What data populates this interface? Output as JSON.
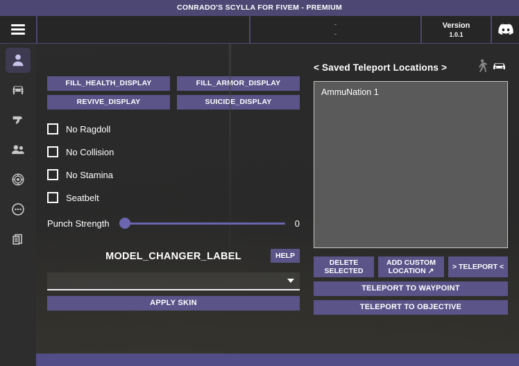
{
  "window": {
    "title": "CONRADO'S SCYLLA FOR FIVEM - PREMIUM"
  },
  "topbar": {
    "menu_icon": "hamburger-menu-icon",
    "blank_panel": "",
    "coords_line1": "-",
    "coords_line2": "-",
    "version_label": "Version",
    "version_number": "1.0.1",
    "discord_icon": "discord-icon"
  },
  "sidebar": {
    "items": [
      {
        "name": "player",
        "icon": "person-icon",
        "active": true
      },
      {
        "name": "vehicle",
        "icon": "car-icon",
        "active": false
      },
      {
        "name": "weapons",
        "icon": "pistol-icon",
        "active": false
      },
      {
        "name": "players",
        "icon": "people-icon",
        "active": false
      },
      {
        "name": "esp",
        "icon": "radar-icon",
        "active": false
      },
      {
        "name": "misc",
        "icon": "dots-circle-icon",
        "active": false
      },
      {
        "name": "logs",
        "icon": "documents-icon",
        "active": false
      }
    ]
  },
  "player_panel": {
    "buttons_row1": [
      "FILL_HEALTH_DISPLAY",
      "FILL_ARMOR_DISPLAY"
    ],
    "buttons_row2": [
      "REVIVE_DISPLAY",
      "SUICIDE_DISPLAY"
    ],
    "checkboxes": [
      {
        "label": "No Ragdoll",
        "checked": false
      },
      {
        "label": "No Collision",
        "checked": false
      },
      {
        "label": "No Stamina",
        "checked": false
      },
      {
        "label": "Seatbelt",
        "checked": false
      }
    ],
    "slider": {
      "label": "Punch Strength",
      "value": "0",
      "percent": 0
    },
    "model_changer": {
      "title": "MODEL_CHANGER_LABEL",
      "help_label": "HELP",
      "dropdown_value": "",
      "dropdown_caret": "chevron-down-icon",
      "apply_label": "APPLY SKIN"
    }
  },
  "teleport_panel": {
    "title": "< Saved Teleport Locations >",
    "mode_icons": [
      {
        "name": "walking-person-icon",
        "active": false
      },
      {
        "name": "car-icon",
        "active": true
      }
    ],
    "locations": [
      "AmmuNation 1"
    ],
    "buttons": {
      "delete_selected": "DELETE SELECTED",
      "add_custom_location": "ADD CUSTOM LOCATION ↗",
      "teleport": "> TELEPORT <",
      "teleport_waypoint": "TELEPORT TO WAYPOINT",
      "teleport_objective": "TELEPORT TO OBJECTIVE"
    }
  },
  "colors": {
    "accent_purple": "#5a5489",
    "titlebar_purple": "#4d4873",
    "footer_purple": "#534d87",
    "panel_dark": "#2d2d2d",
    "list_gray": "#5a5a5a"
  }
}
